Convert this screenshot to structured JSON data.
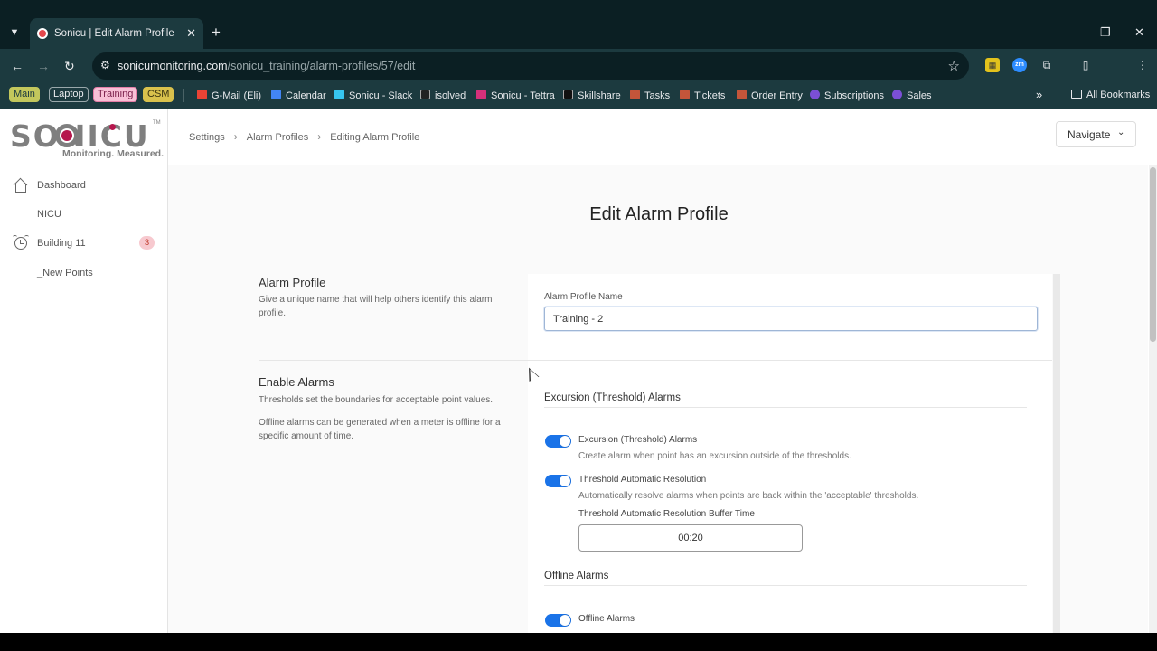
{
  "browser": {
    "tab_title": "Sonicu | Edit Alarm Profile",
    "close_glyph": "✕",
    "new_tab_glyph": "+",
    "url_host": "sonicumonitoring.com",
    "url_path": "/sonicu_training/alarm-profiles/57/edit",
    "bookmark_groups": [
      "Main",
      "Laptop",
      "Training",
      "CSM"
    ],
    "bookmarks": [
      {
        "label": "G-Mail (Eli)",
        "color": "#ea4335"
      },
      {
        "label": "Calendar",
        "color": "#4285f4"
      },
      {
        "label": "Sonicu - Slack",
        "color": "#36c5f0"
      },
      {
        "label": "isolved",
        "color": "#222222"
      },
      {
        "label": "Sonicu - Tettra",
        "color": "#d6307a"
      },
      {
        "label": "Skillshare",
        "color": "#111111"
      },
      {
        "label": "Tasks",
        "color": "#c4553a"
      },
      {
        "label": "Tickets",
        "color": "#c4553a"
      },
      {
        "label": "Order Entry",
        "color": "#c4553a"
      },
      {
        "label": "Subscriptions",
        "color": "#7b4fd6"
      },
      {
        "label": "Sales",
        "color": "#7b4fd6"
      }
    ],
    "all_bookmarks": "All Bookmarks"
  },
  "sidebar": {
    "logo_text": "SONICU",
    "logo_tagline": "Monitoring. Measured.",
    "logo_tm": "TM",
    "items": [
      {
        "label": "Dashboard",
        "icon": "house-icon"
      },
      {
        "label": "NICU",
        "icon": ""
      },
      {
        "label": "Building 11",
        "icon": "alarm-clock-icon",
        "badge": "3"
      },
      {
        "label": "_New Points",
        "icon": ""
      }
    ]
  },
  "header": {
    "breadcrumbs": [
      "Settings",
      "Alarm Profiles",
      "Editing Alarm Profile"
    ],
    "navigate_label": "Navigate"
  },
  "main": {
    "page_title": "Edit Alarm Profile",
    "alarm_profile": {
      "title": "Alarm Profile",
      "desc": "Give a unique name that will help others identify this alarm profile.",
      "field_label": "Alarm Profile Name",
      "field_value": "Training - 2"
    },
    "enable_alarms": {
      "title": "Enable Alarms",
      "desc1": "Thresholds set the boundaries for acceptable point values.",
      "desc2": "Offline alarms can be generated when a meter is offline for a specific amount of time."
    },
    "excursion": {
      "title": "Excursion (Threshold) Alarms",
      "toggle1_label": "Excursion (Threshold) Alarms",
      "toggle1_desc": "Create alarm when point has an excursion outside of the thresholds.",
      "toggle1_on": true,
      "toggle2_label": "Threshold Automatic Resolution",
      "toggle2_desc": "Automatically resolve alarms when points are back within the 'acceptable' thresholds.",
      "toggle2_on": true,
      "buffer_label": "Threshold Automatic Resolution Buffer Time",
      "buffer_value": "00:20"
    },
    "offline": {
      "title": "Offline Alarms",
      "toggle_label": "Offline Alarms",
      "toggle_on": true
    }
  },
  "colors": {
    "accent": "#1a73e8",
    "brand_magenta": "#b5174d",
    "badge_bg": "#f7c9cf"
  }
}
